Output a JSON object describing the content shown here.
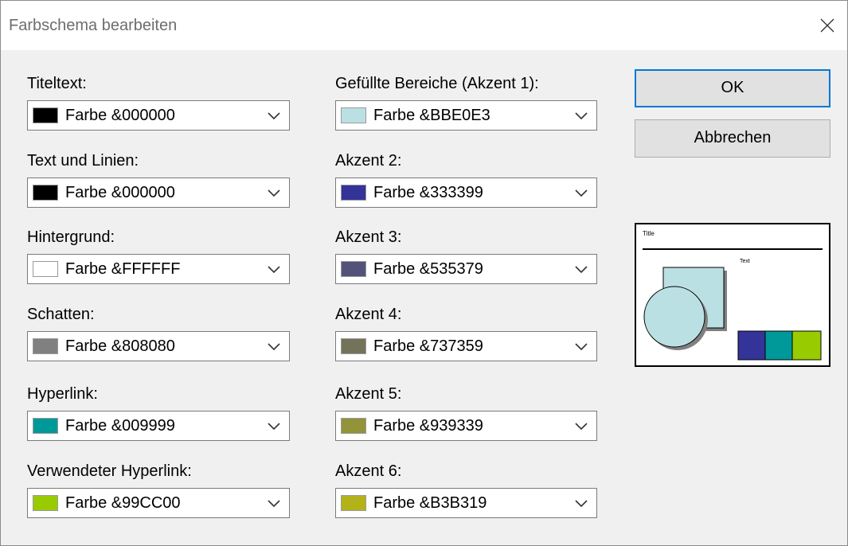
{
  "dialog": {
    "title": "Farbschema bearbeiten",
    "close_icon": "close-icon"
  },
  "left_column": [
    {
      "label": "Titeltext:",
      "value": "Farbe &000000",
      "color": "#000000"
    },
    {
      "label": "Text und Linien:",
      "value": "Farbe &000000",
      "color": "#000000"
    },
    {
      "label": "Hintergrund:",
      "value": "Farbe &FFFFFF",
      "color": "#FFFFFF"
    },
    {
      "label": "Schatten:",
      "value": "Farbe &808080",
      "color": "#808080"
    },
    {
      "label": "Hyperlink:",
      "value": "Farbe &009999",
      "color": "#009999"
    },
    {
      "label": "Verwendeter Hyperlink:",
      "value": "Farbe &99CC00",
      "color": "#99CC00"
    }
  ],
  "right_column": [
    {
      "label": "Gefüllte Bereiche (Akzent 1):",
      "value": "Farbe &BBE0E3",
      "color": "#BBE0E3"
    },
    {
      "label": "Akzent 2:",
      "value": "Farbe &333399",
      "color": "#333399"
    },
    {
      "label": "Akzent 3:",
      "value": "Farbe &535379",
      "color": "#535379"
    },
    {
      "label": "Akzent 4:",
      "value": "Farbe &737359",
      "color": "#737359"
    },
    {
      "label": "Akzent 5:",
      "value": "Farbe &939339",
      "color": "#939339"
    },
    {
      "label": "Akzent 6:",
      "value": "Farbe &B3B319",
      "color": "#B3B319"
    }
  ],
  "buttons": {
    "ok": "OK",
    "cancel": "Abbrechen"
  },
  "preview": {
    "title": "Title",
    "text": "Text"
  },
  "colors": {
    "accent_focus": "#0078d7"
  }
}
